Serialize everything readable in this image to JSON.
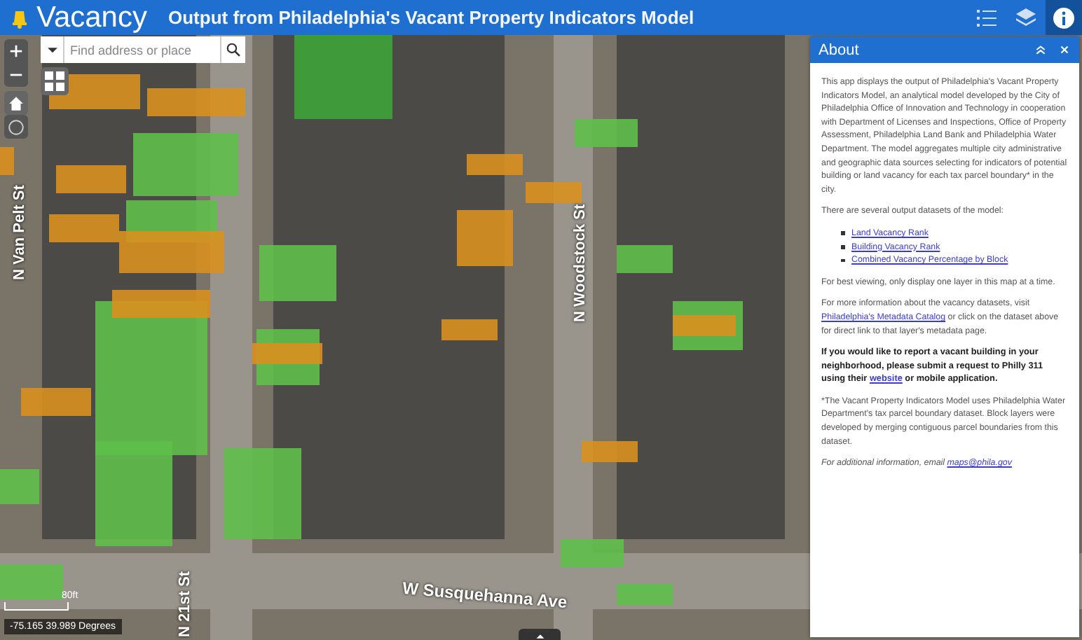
{
  "header": {
    "app_name": "Vacancy",
    "title": "Output from Philadelphia's Vacant Property Indicators Model"
  },
  "search": {
    "placeholder": "Find address or place"
  },
  "map": {
    "street_labels": [
      {
        "text": "N Van Pelt St",
        "kind": "vertical"
      },
      {
        "text": "N Woodstock St",
        "kind": "vertical"
      },
      {
        "text": "N 21st St",
        "kind": "vertical"
      },
      {
        "text": "W Susquehanna Ave",
        "kind": "tilted"
      }
    ],
    "scale": "80ft",
    "coordinates": "-75.165 39.989 Degrees"
  },
  "about_panel": {
    "title": "About",
    "intro": "This app displays the output of Philadelphia's Vacant Property Indicators Model, an analytical model developed by the City of Philadelphia Office of Innovation and Technology in cooperation with Department of Licenses and Inspections, Office of Property Assessment, Philadelphia Land Bank and Philadelphia Water Department. The model aggregates multiple city administrative and geographic data sources selecting for indicators of potential building or land vacancy for each tax parcel boundary* in the city.",
    "datasets_intro": "There are several output datasets of the model:",
    "datasets": [
      "Land Vacancy Rank",
      "Building Vacancy Rank",
      "Combined Vacancy Percentage by Block"
    ],
    "viewing_note": "For best viewing, only display one layer in this map at a time.",
    "more_info": {
      "before": "For more information about the vacancy datasets, visit ",
      "link": "Philadelphia's Metadata Catalog",
      "after": " or click on the dataset above for direct link to that layer's metadata page."
    },
    "report": {
      "before": "If you would like to report a vacant building in your neighborhood, please submit a request to Philly 311 using their ",
      "link": "website",
      "after": " or mobile application."
    },
    "footnote": "*The Vacant Property Indicators Model uses Philadelphia Water Department's tax parcel boundary dataset.  Block layers were developed by merging contiguous parcel boundaries from this dataset.",
    "contact": {
      "before": "For additional information, email ",
      "link": "maps@phila.gov"
    }
  }
}
